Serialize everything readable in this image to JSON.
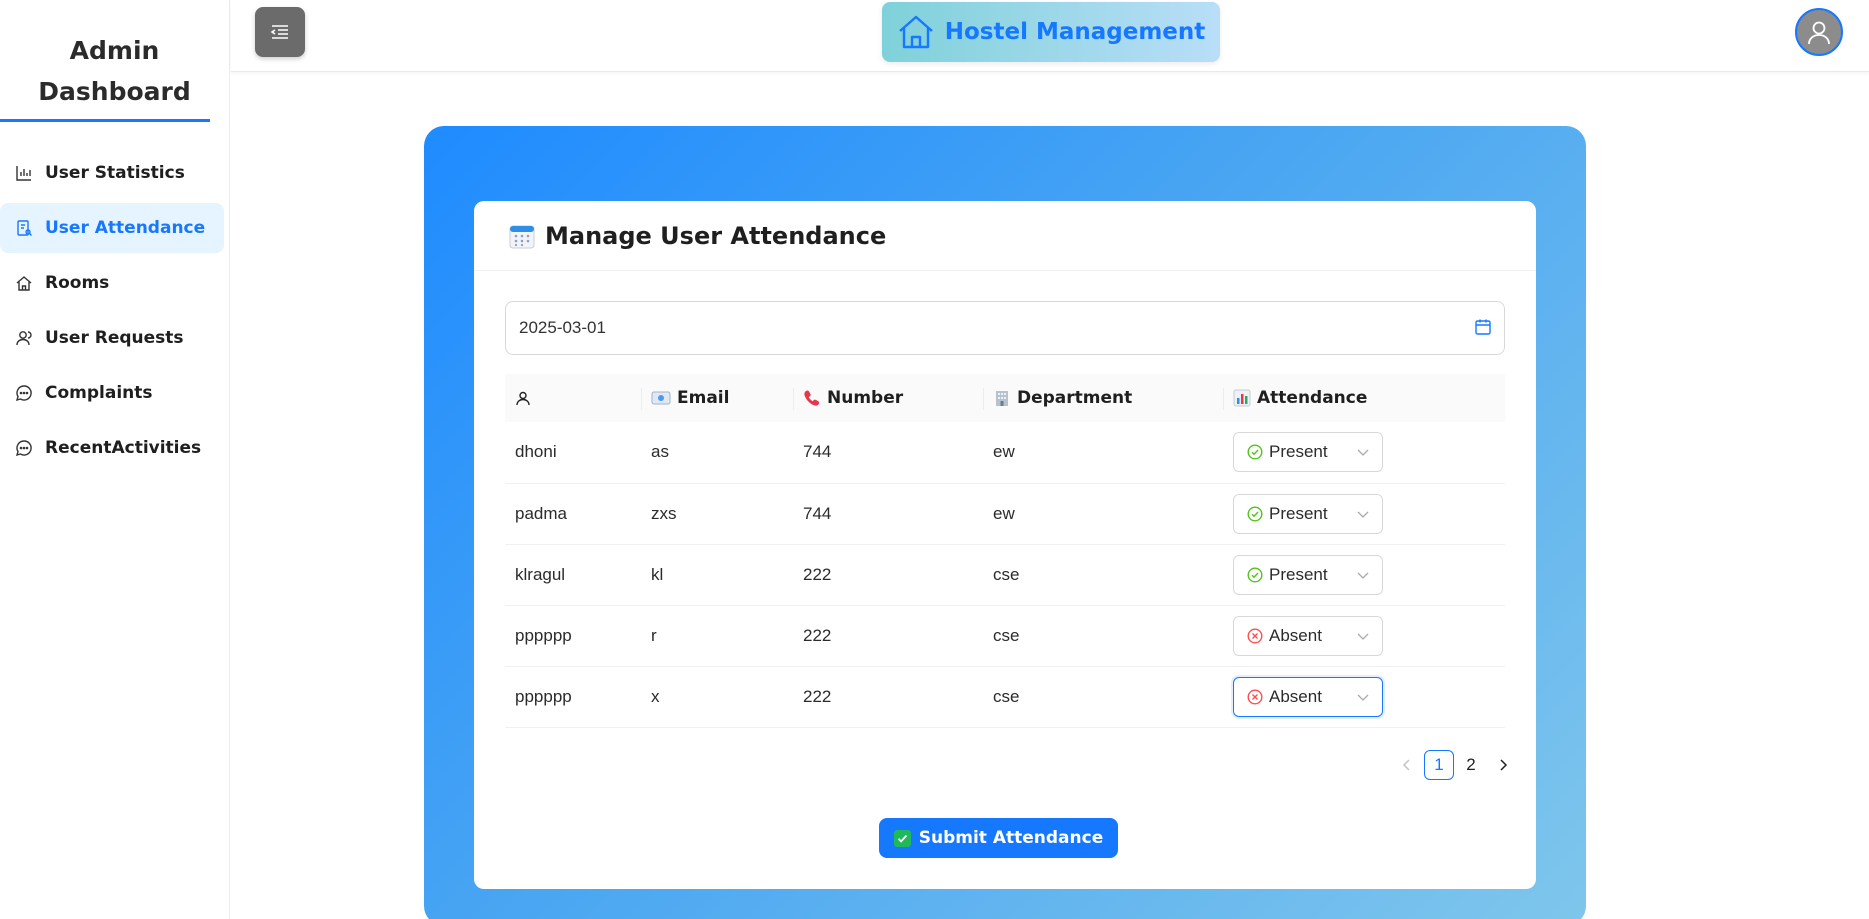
{
  "sidebar": {
    "brand_line1": "Admin",
    "brand_line2": "Dashboard",
    "items": [
      {
        "label": "User Statistics",
        "icon": "bar-chart-icon"
      },
      {
        "label": "User Attendance",
        "icon": "attendance-icon",
        "active": true
      },
      {
        "label": "Rooms",
        "icon": "home-icon"
      },
      {
        "label": "User Requests",
        "icon": "users-icon"
      },
      {
        "label": "Complaints",
        "icon": "message-icon"
      },
      {
        "label": "RecentActivities",
        "icon": "message-icon"
      }
    ]
  },
  "header": {
    "title": "Hostel Management",
    "title_icon": "home-icon",
    "menu_icon": "menu-fold-icon",
    "avatar_icon": "user-icon"
  },
  "card": {
    "title": "Manage User Attendance",
    "title_icon": "calendar-emoji-icon",
    "date_value": "2025-03-01",
    "table": {
      "columns": [
        {
          "label": "",
          "icon": "user-icon"
        },
        {
          "label": "Email",
          "icon": "id-card-icon"
        },
        {
          "label": "Number",
          "icon": "phone-icon"
        },
        {
          "label": "Department",
          "icon": "building-icon"
        },
        {
          "label": "Attendance",
          "icon": "chart-icon"
        }
      ],
      "rows": [
        {
          "name": "dhoni",
          "email": "as",
          "number": "744",
          "department": "ew",
          "attendance": "Present"
        },
        {
          "name": "padma",
          "email": "zxs",
          "number": "744",
          "department": "ew",
          "attendance": "Present"
        },
        {
          "name": "klragul",
          "email": "kl",
          "number": "222",
          "department": "cse",
          "attendance": "Present"
        },
        {
          "name": "pppppp",
          "email": "r",
          "number": "222",
          "department": "cse",
          "attendance": "Absent"
        },
        {
          "name": "pppppp",
          "email": "x",
          "number": "222",
          "department": "cse",
          "attendance": "Absent"
        }
      ]
    },
    "pagination": {
      "pages": [
        "1",
        "2"
      ],
      "current": "1"
    },
    "submit_label": "Submit Attendance"
  },
  "colors": {
    "accent": "#1677ff",
    "present": "#52c41a",
    "absent": "#ff4d4f"
  }
}
